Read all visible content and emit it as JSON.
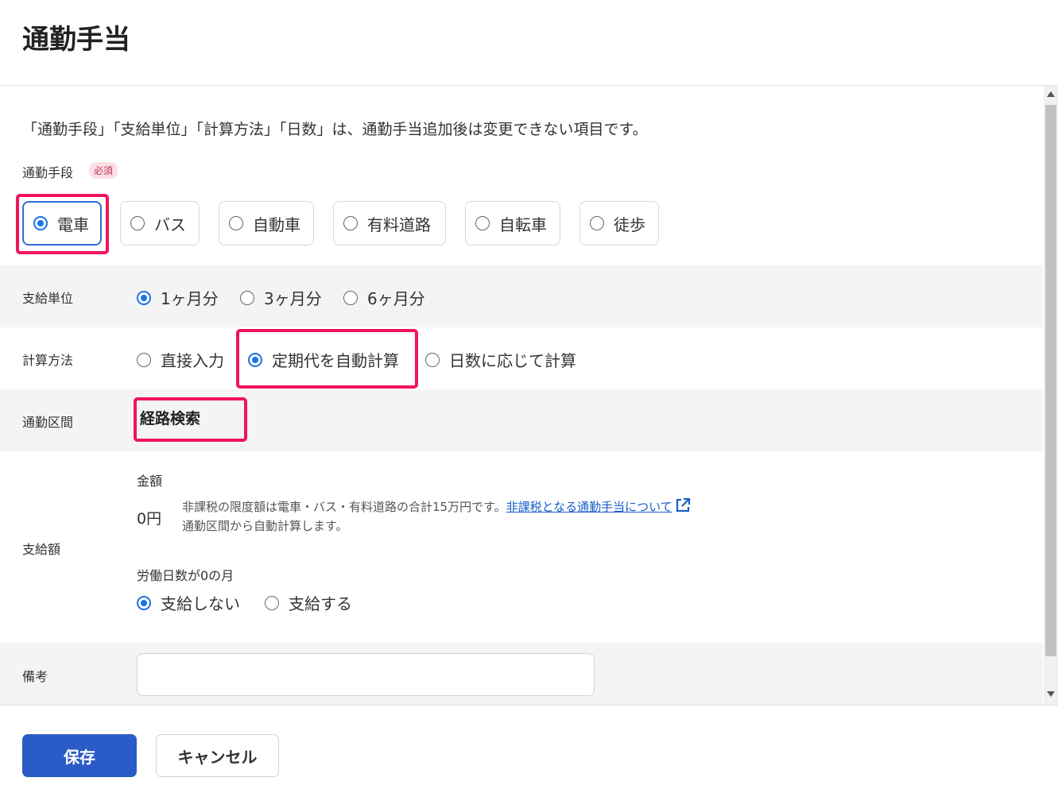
{
  "page": {
    "title": "通勤手当"
  },
  "notice": "「通勤手段」「支給単位」「計算方法」「日数」は、通勤手当追加後は変更できない項目です。",
  "commute_mode": {
    "label": "通勤手段",
    "required_badge": "必須",
    "options": [
      {
        "label": "電車",
        "selected": true
      },
      {
        "label": "バス",
        "selected": false
      },
      {
        "label": "自動車",
        "selected": false
      },
      {
        "label": "有料道路",
        "selected": false
      },
      {
        "label": "自転車",
        "selected": false
      },
      {
        "label": "徒歩",
        "selected": false
      }
    ]
  },
  "payment_unit": {
    "label": "支給単位",
    "options": [
      {
        "label": "1ヶ月分",
        "selected": true
      },
      {
        "label": "3ヶ月分",
        "selected": false
      },
      {
        "label": "6ヶ月分",
        "selected": false
      }
    ]
  },
  "calc_method": {
    "label": "計算方法",
    "options": [
      {
        "label": "直接入力",
        "selected": false
      },
      {
        "label": "定期代を自動計算",
        "selected": true
      },
      {
        "label": "日数に応じて計算",
        "selected": false
      }
    ]
  },
  "route": {
    "label": "通勤区間",
    "button_label": "経路検索"
  },
  "payment_amount": {
    "label": "支給額",
    "amount_label": "金額",
    "amount_value": "0円",
    "note_text": "非課税の限度額は電車・バス・有料道路の合計15万円です。",
    "note_link": "非課税となる通勤手当について",
    "note_line2": "通勤区間から自動計算します。",
    "zero_days_label": "労働日数が0の月",
    "zero_days_options": [
      {
        "label": "支給しない",
        "selected": true
      },
      {
        "label": "支給する",
        "selected": false
      }
    ]
  },
  "remarks": {
    "label": "備考",
    "value": ""
  },
  "footer": {
    "save_label": "保存",
    "cancel_label": "キャンセル"
  },
  "colors": {
    "primary": "#2a5bc7",
    "radio": "#1a73e8",
    "highlight": "#f0145a",
    "link": "#1a5fc8",
    "badge_bg": "#fbe0e6",
    "badge_text": "#c03050",
    "row_gray": "#f4f4f4"
  }
}
